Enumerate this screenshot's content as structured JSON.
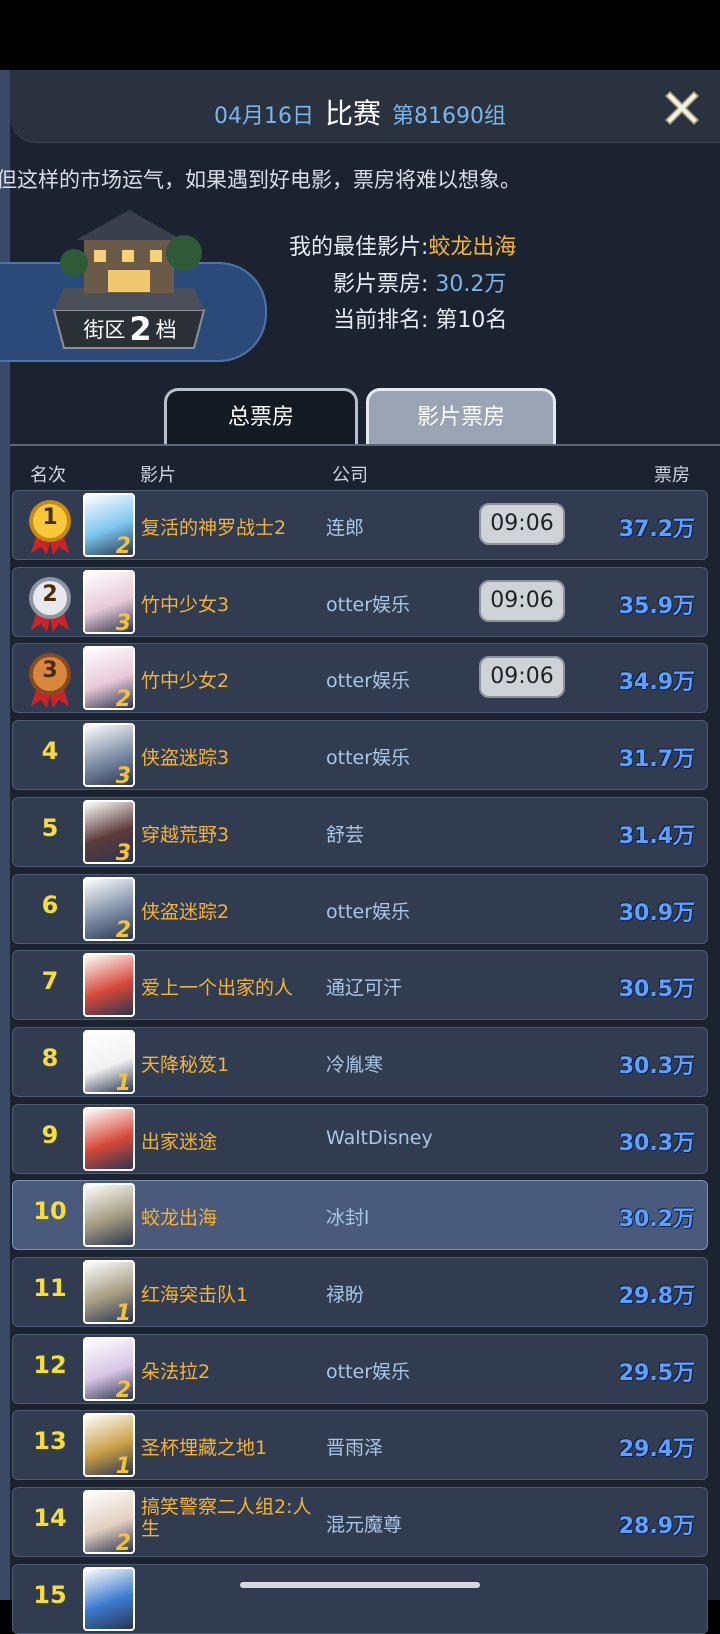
{
  "header": {
    "date": "04月16日",
    "match": "比赛",
    "group": "第81690组"
  },
  "banner": "但这样的市场运气，如果遇到好电影，票房将难以想象。",
  "district": {
    "prefix": "街区",
    "level": "2",
    "suffix": "档"
  },
  "my_info": {
    "best_film_label": "我的最佳影片:",
    "best_film": "蛟龙出海",
    "box_label": "影片票房:",
    "box_value": "30.2万",
    "rank_label": "当前排名:",
    "rank_value": "第10名"
  },
  "tabs": {
    "total": "总票房",
    "film": "影片票房"
  },
  "columns": {
    "rank": "名次",
    "film": "影片",
    "company": "公司",
    "box": "票房"
  },
  "rows": [
    {
      "rank": "1",
      "film": "复活的神罗战士2",
      "company": "连郎",
      "time": "09:06",
      "box": "37.2万",
      "level": "2",
      "medal": "gold",
      "poster_color": "#7cc6f0"
    },
    {
      "rank": "2",
      "film": "竹中少女3",
      "company": "otter娱乐",
      "time": "09:06",
      "box": "35.9万",
      "level": "3",
      "medal": "silver",
      "poster_color": "#e8c9d8"
    },
    {
      "rank": "3",
      "film": "竹中少女2",
      "company": "otter娱乐",
      "time": "09:06",
      "box": "34.9万",
      "level": "2",
      "medal": "bronze",
      "poster_color": "#e8c9d8"
    },
    {
      "rank": "4",
      "film": "侠盗迷踪3",
      "company": "otter娱乐",
      "box": "31.7万",
      "level": "3",
      "poster_color": "#7e8ea6"
    },
    {
      "rank": "5",
      "film": "穿越荒野3",
      "company": "舒芸",
      "box": "31.4万",
      "level": "3",
      "poster_color": "#5d3a3a"
    },
    {
      "rank": "6",
      "film": "侠盗迷踪2",
      "company": "otter娱乐",
      "box": "30.9万",
      "level": "2",
      "poster_color": "#7e8ea6"
    },
    {
      "rank": "7",
      "film": "爱上一个出家的人",
      "company": "通辽可汗",
      "box": "30.5万",
      "level": "",
      "poster_color": "#d84a3a"
    },
    {
      "rank": "8",
      "film": "天降秘笈1",
      "company": "冷胤寒",
      "box": "30.3万",
      "level": "1",
      "poster_color": "#f2f2f2"
    },
    {
      "rank": "9",
      "film": "出家迷途",
      "company": "WaltDisney",
      "box": "30.3万",
      "level": "",
      "poster_color": "#d84a3a"
    },
    {
      "rank": "10",
      "film": "蛟龙出海",
      "company": "冰封l",
      "box": "30.2万",
      "level": "",
      "poster_color": "#a69c82",
      "me": true
    },
    {
      "rank": "11",
      "film": "红海突击队1",
      "company": "禄盼",
      "box": "29.8万",
      "level": "1",
      "poster_color": "#a69c82"
    },
    {
      "rank": "12",
      "film": "朵法拉2",
      "company": "otter娱乐",
      "box": "29.5万",
      "level": "2",
      "poster_color": "#d9c6e6"
    },
    {
      "rank": "13",
      "film": "圣杯埋藏之地1",
      "company": "晋雨泽",
      "box": "29.4万",
      "level": "1",
      "poster_color": "#c9a046"
    },
    {
      "rank": "14",
      "film": "搞笑警察二人组2:人生",
      "company": "混元魔尊",
      "box": "28.9万",
      "level": "2",
      "poster_color": "#e3d0c0"
    },
    {
      "rank": "15",
      "film": "",
      "company": "",
      "box": "",
      "level": "",
      "poster_color": "#3a7bd0"
    }
  ]
}
